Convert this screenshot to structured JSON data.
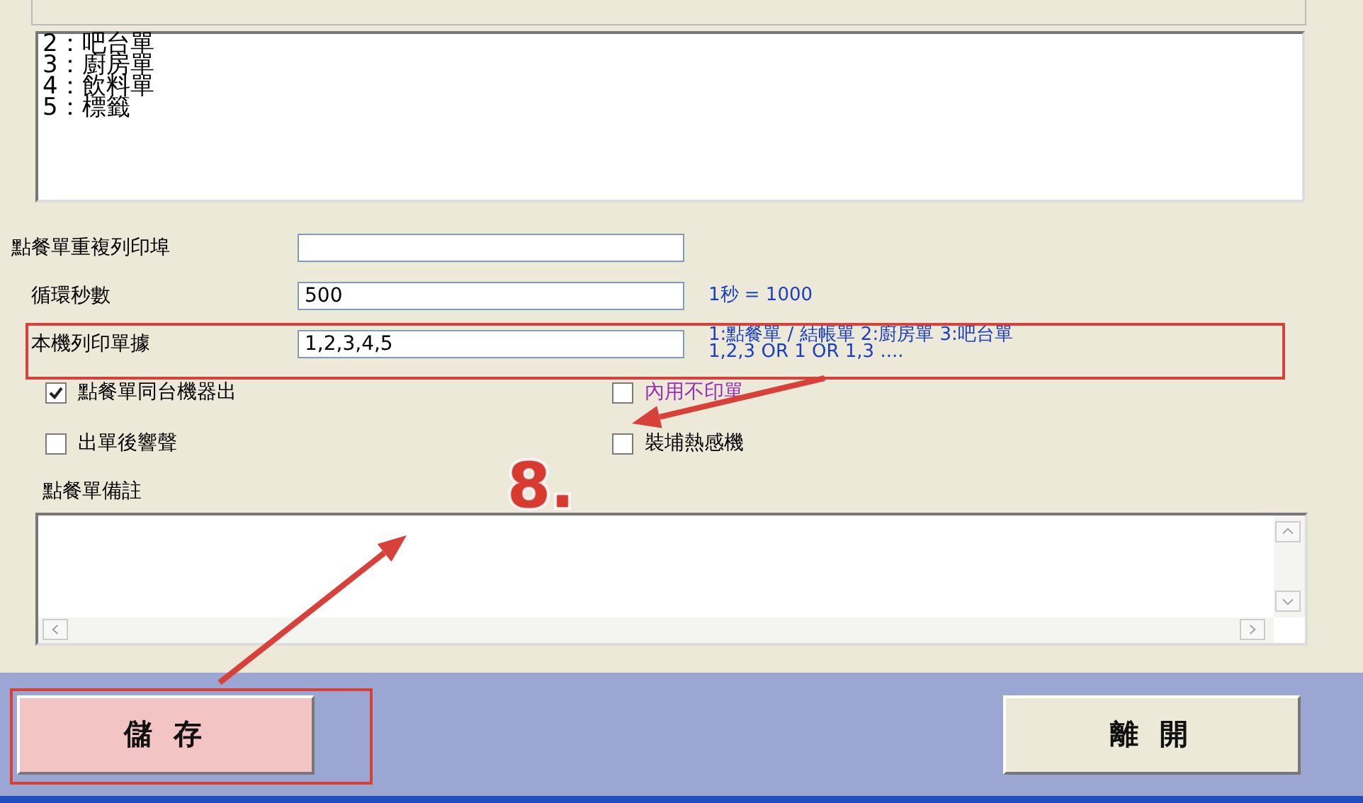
{
  "print_types_list": {
    "lines": [
      "2：吧台單",
      "3：廚房單",
      "4：飲料單",
      "5：標籤"
    ]
  },
  "fields": [
    {
      "label": "點餐單重複列印埠"
    },
    {
      "label": "循環秒數",
      "value": "500",
      "hint": [
        "1秒 = 1000"
      ]
    },
    {
      "label": "本機列印單據",
      "value": "1,2,3,4,5",
      "hint": [
        "1:點餐單 / 結帳單   2:廚房單   3:吧台單",
        "1,2,3 OR 1 OR 1,3 ...."
      ],
      "highlighted": true
    }
  ],
  "checkboxes": [
    {
      "label": "點餐單同台機器出",
      "checked": true,
      "color": "#000000"
    },
    {
      "label": "內用不印單",
      "checked": false,
      "color": "#9a30b0"
    },
    {
      "label": "出單後響聲",
      "checked": false,
      "color": "#000000"
    },
    {
      "label": "裝埔熱感機",
      "checked": false,
      "color": "#000000"
    }
  ],
  "remark": {
    "label": "點餐單備註"
  },
  "buttons": [
    {
      "label": "儲 存",
      "highlighted": true
    },
    {
      "label": "離 開",
      "highlighted": false
    }
  ],
  "callout": {
    "text": "8."
  }
}
